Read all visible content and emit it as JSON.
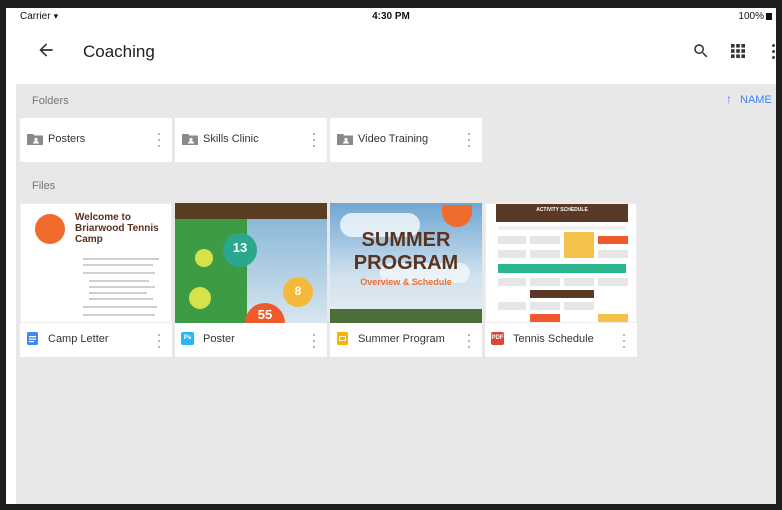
{
  "status_bar": {
    "carrier": "Carrier",
    "time": "4:30 PM",
    "battery": "100%"
  },
  "app_bar": {
    "title": "Coaching",
    "back_icon": "arrow-left-icon",
    "search_icon": "search-icon",
    "grid_icon": "grid-view-icon",
    "more_icon": "more-vert-icon"
  },
  "folders_label": "Folders",
  "files_label": "Files",
  "sort": {
    "label": "NAME",
    "direction": "ascending"
  },
  "folders": [
    {
      "name": "Posters"
    },
    {
      "name": "Skills Clinic"
    },
    {
      "name": "Video Training"
    }
  ],
  "files": [
    {
      "name": "Camp Letter",
      "type": "docs",
      "badge_color": "#4285f4",
      "thumb_title": "Welcome to Briarwood Tennis Camp"
    },
    {
      "name": "Poster",
      "type": "photoshop",
      "badge_color": "#29b6f6",
      "badge_text": "Ps",
      "numbers": [
        "13",
        "8",
        "55"
      ]
    },
    {
      "name": "Summer Program",
      "type": "slides",
      "badge_color": "#f4b400",
      "thumb_line1": "SUMMER",
      "thumb_line2": "PROGRAM",
      "thumb_sub": "Overview & Schedule"
    },
    {
      "name": "Tennis Schedule",
      "type": "pdf",
      "badge_color": "#db4437",
      "badge_text": "PDF",
      "thumb_title": "ACTIVITY SCHEDULE"
    }
  ],
  "colors": {
    "accent": "#4285f4",
    "background": "#e8e8e8",
    "card": "#ffffff"
  }
}
